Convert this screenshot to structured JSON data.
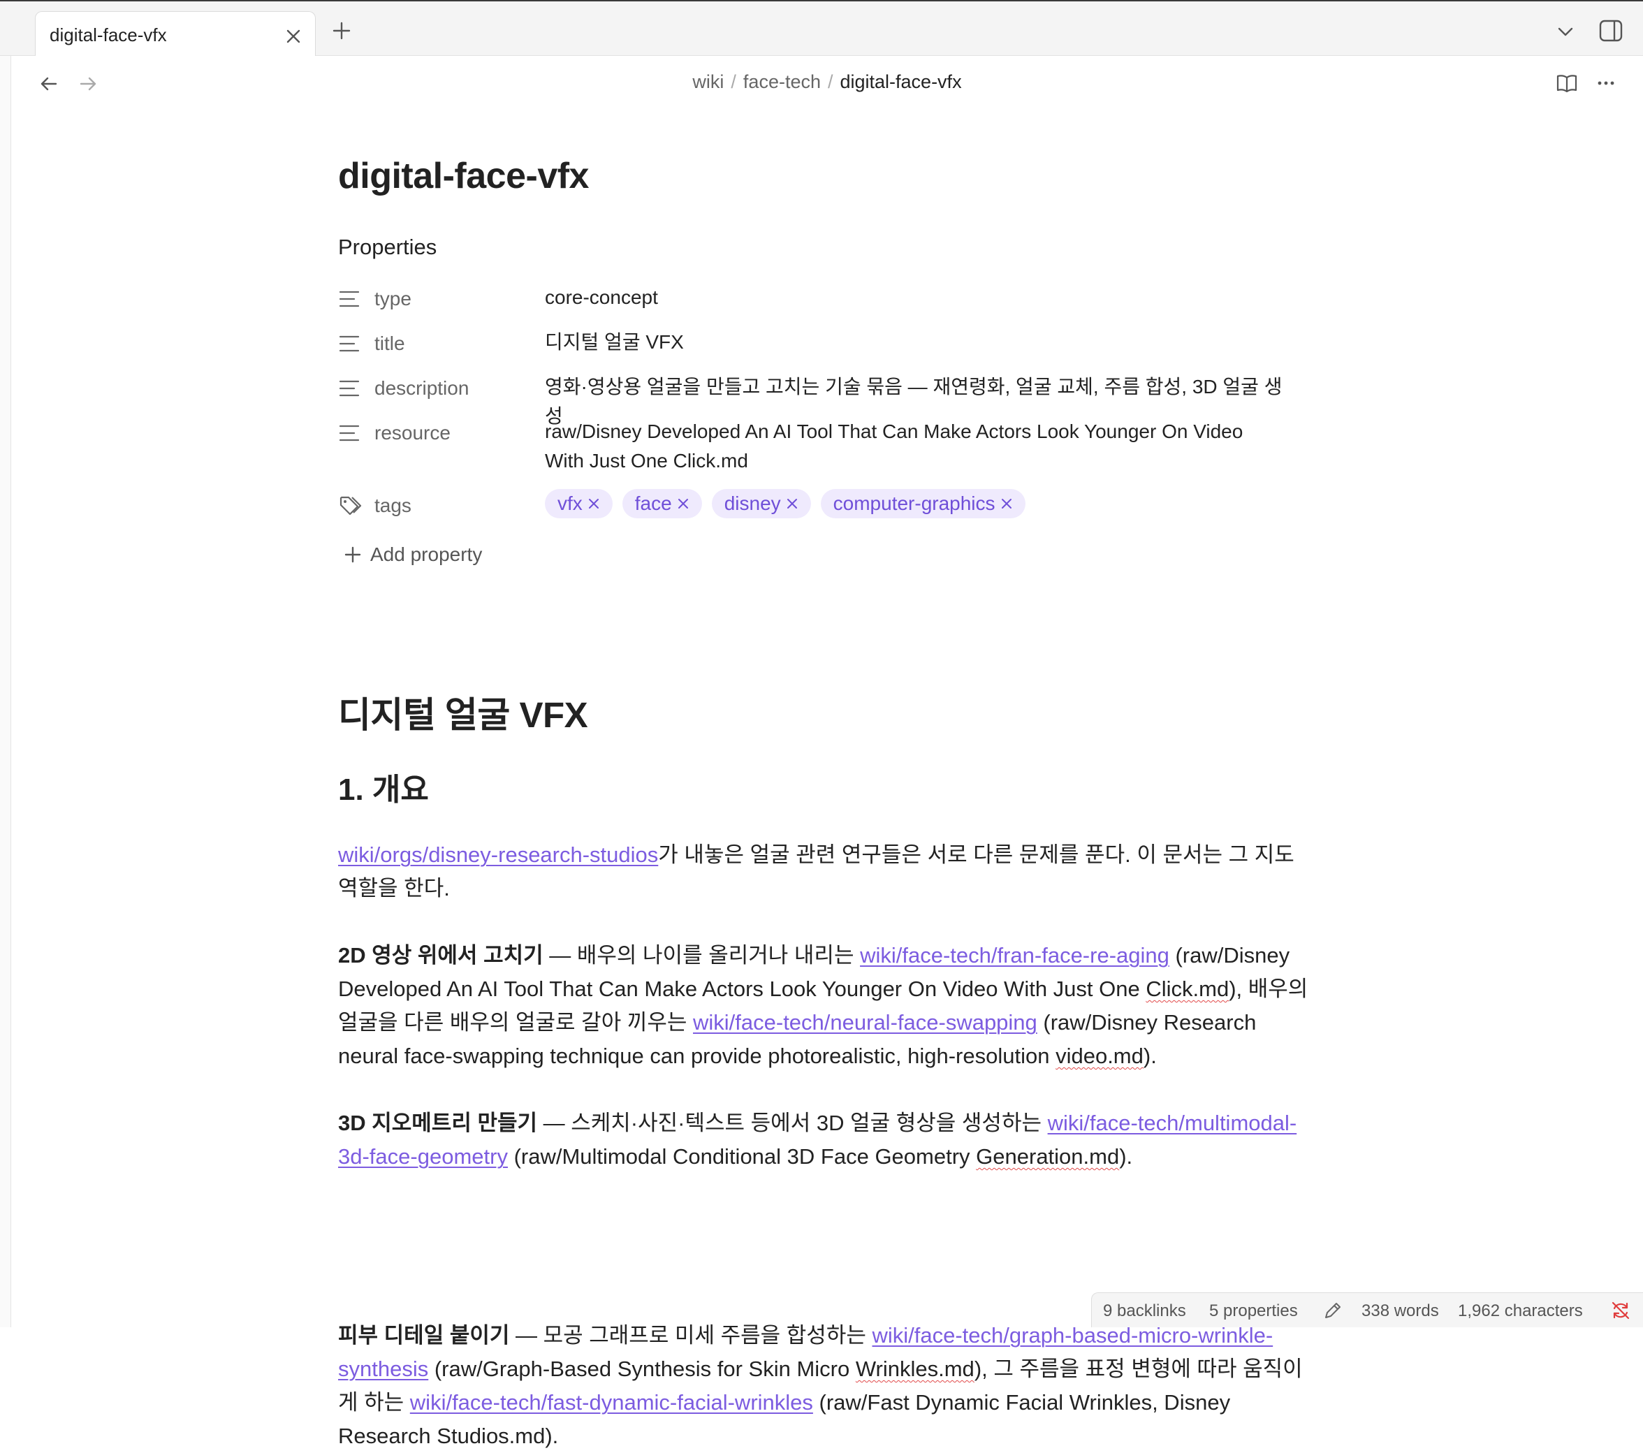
{
  "tab": {
    "title": "digital-face-vfx"
  },
  "breadcrumb": [
    "wiki",
    "face-tech",
    "digital-face-vfx"
  ],
  "page": {
    "title": "digital-face-vfx"
  },
  "properties": {
    "heading": "Properties",
    "items": [
      {
        "key": "type",
        "value": "core-concept",
        "icon": "list-icon"
      },
      {
        "key": "title",
        "value": "디지털 얼굴 VFX",
        "icon": "list-icon"
      },
      {
        "key": "description",
        "value": "영화·영상용 얼굴을 만들고 고치는 기술 묶음 — 재연령화, 얼굴 교체, 주름 합성, 3D 얼굴 생성",
        "icon": "list-icon"
      },
      {
        "key": "resource",
        "value": "raw/Disney Developed An AI Tool That Can Make Actors Look Younger On Video With Just One Click.md",
        "icon": "list-icon"
      }
    ],
    "tags_key": "tags",
    "tags": [
      "vfx",
      "face",
      "disney",
      "computer-graphics"
    ],
    "add_label": "Add property"
  },
  "content": {
    "h1": "디지털 얼굴 VFX",
    "h2": "1. 개요",
    "p1": {
      "link": "wiki/orgs/disney-research-studios",
      "text": "가 내놓은 얼굴 관련 연구들은 서로 다른 문제를 푼다. 이 문서는 그 지도 역할을 한다."
    },
    "p2": {
      "bold": "2D 영상 위에서 고치기",
      "t1": " — 배우의 나이를 올리거나 내리는 ",
      "link1": "wiki/face-tech/fran-face-re-aging",
      "t2": " (raw/Disney Developed An AI Tool That Can Make Actors Look Younger On Video With Just One ",
      "w1": "Click.md",
      "t3": "), 배우의 얼굴을 다른 배우의 얼굴로 갈아 끼우는 ",
      "link2": "wiki/face-tech/neural-face-swapping",
      "t4": " (raw/Disney Research neural face-swapping technique can provide photorealistic, high-resolution ",
      "w2": "video.md",
      "t5": ")."
    },
    "p3": {
      "bold": "3D 지오메트리 만들기",
      "t1": " — 스케치·사진·텍스트 등에서 3D 얼굴 형상을 생성하는 ",
      "link1": "wiki/face-tech/multimodal-3d-face-geometry",
      "t2": " (raw/Multimodal Conditional 3D Face Geometry ",
      "w1": "Generation.md",
      "t3": ")."
    },
    "p4": {
      "bold": "피부 디테일 붙이기",
      "t1": " — 모공 그래프로 미세 주름을 합성하는 ",
      "link1": "wiki/face-tech/graph-based-micro-wrinkle-synthesis",
      "t2": " (raw/Graph-Based Synthesis for Skin Micro ",
      "w1": "Wrinkles.md",
      "t3": "), 그 주름을 표정 변형에 따라 움직이게 하는 ",
      "link2": "wiki/face-tech/fast-dynamic-facial-wrinkles",
      "t4": " (raw/Fast Dynamic Facial Wrinkles, Disney Research Studios.md)."
    }
  },
  "statusbar": {
    "backlinks": "9 backlinks",
    "properties": "5 properties",
    "words": "338 words",
    "characters": "1,962 characters"
  },
  "colors": {
    "accent": "#7c5ce0",
    "tag_bg": "#efeafd",
    "sync_error": "#e03c3c"
  }
}
